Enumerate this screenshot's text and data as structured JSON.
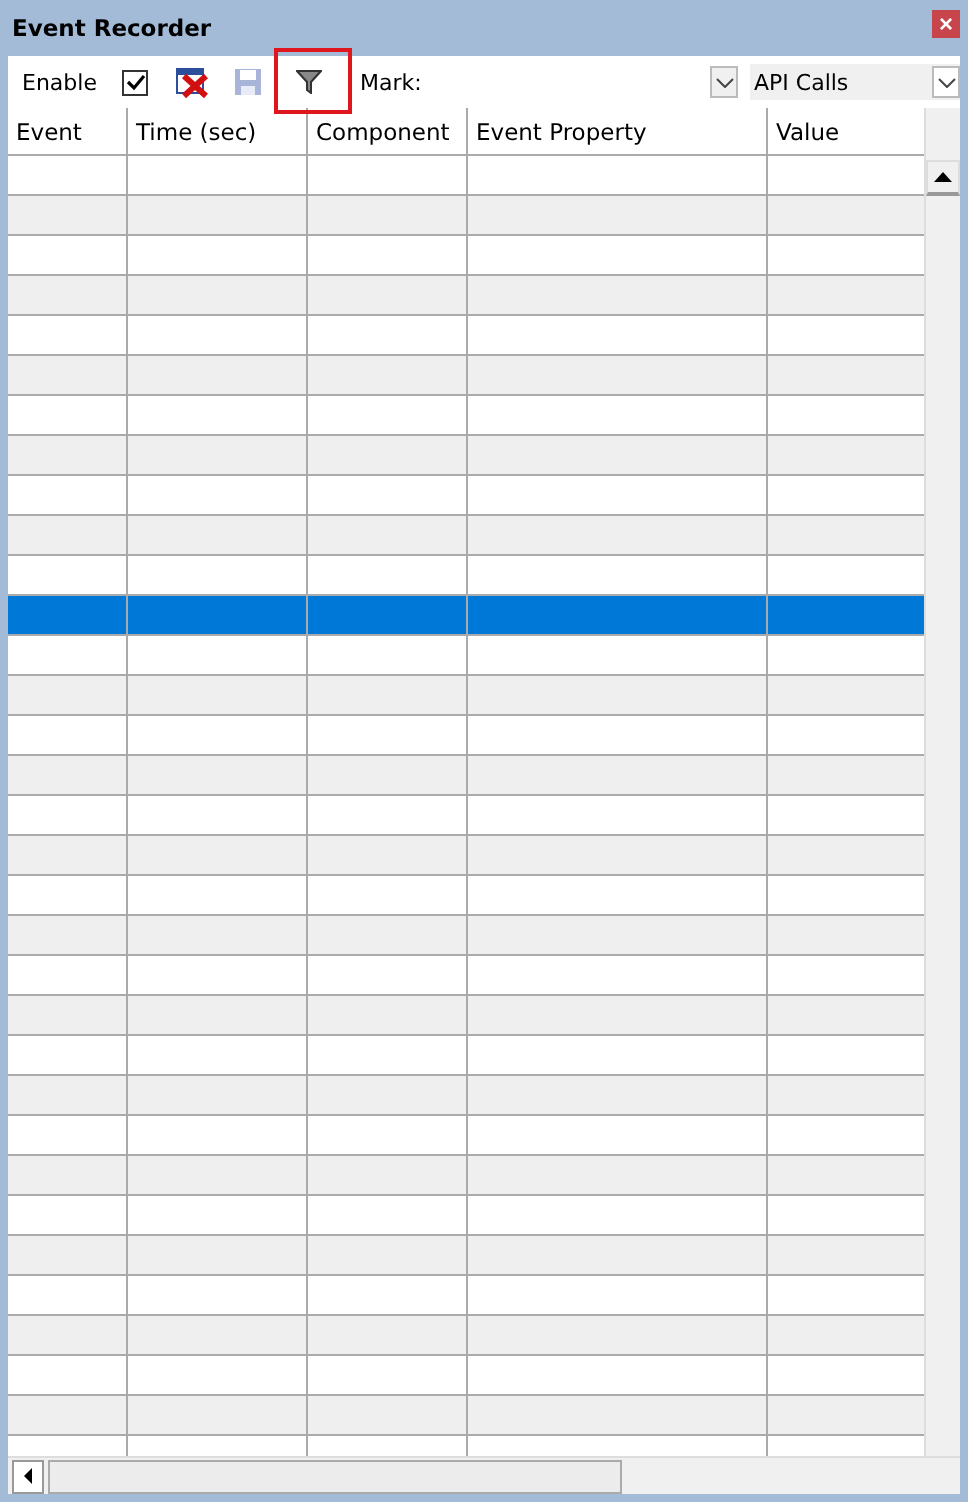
{
  "window": {
    "title": "Event Recorder",
    "close": "×"
  },
  "toolbar": {
    "enable_label": "Enable",
    "enable_checked": true,
    "save_disabled": true,
    "filter_highlighted": true,
    "mark_label": "Mark:",
    "category": "API Calls"
  },
  "table": {
    "columns": [
      "Event",
      "Time (sec)",
      "Component",
      "Event Property",
      "Value"
    ],
    "rows": [
      {
        "selected": false
      },
      {
        "selected": false
      },
      {
        "selected": false
      },
      {
        "selected": false
      },
      {
        "selected": false
      },
      {
        "selected": false
      },
      {
        "selected": false
      },
      {
        "selected": false
      },
      {
        "selected": false
      },
      {
        "selected": false
      },
      {
        "selected": false
      },
      {
        "selected": true
      },
      {
        "selected": false
      },
      {
        "selected": false
      },
      {
        "selected": false
      },
      {
        "selected": false
      },
      {
        "selected": false
      },
      {
        "selected": false
      },
      {
        "selected": false
      },
      {
        "selected": false
      },
      {
        "selected": false
      },
      {
        "selected": false
      },
      {
        "selected": false
      },
      {
        "selected": false
      },
      {
        "selected": false
      },
      {
        "selected": false
      },
      {
        "selected": false
      },
      {
        "selected": false
      },
      {
        "selected": false
      },
      {
        "selected": false
      },
      {
        "selected": false
      },
      {
        "selected": false
      },
      {
        "selected": false
      }
    ]
  }
}
